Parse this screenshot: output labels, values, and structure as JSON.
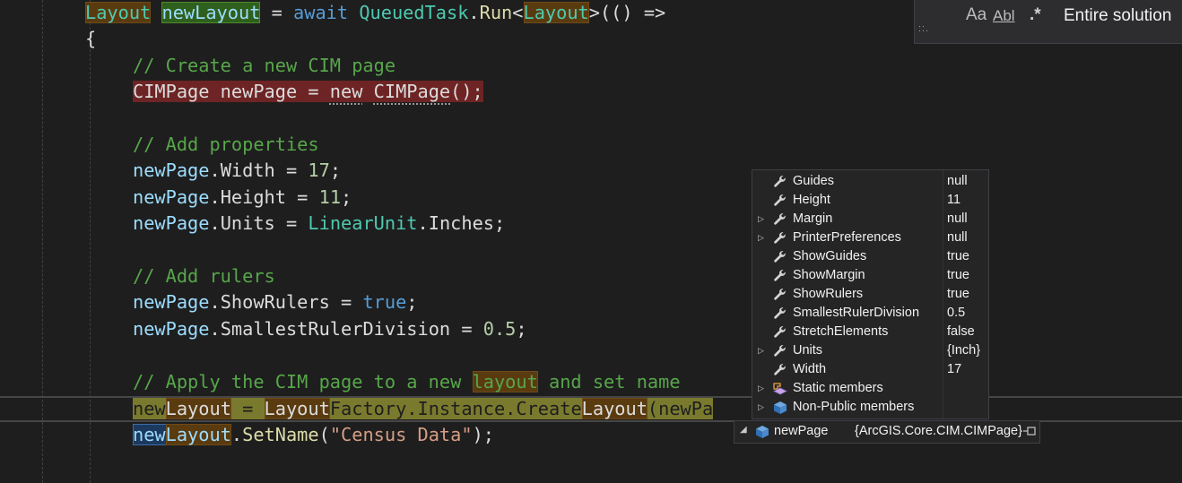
{
  "code": {
    "l1": {
      "t1": "Layout",
      "t2": "newLayout",
      "t3": " = ",
      "t4": "await",
      "t5": "QueuedTask",
      "t6": ".",
      "t7": "Run",
      "t8": "<",
      "t9": "Layout",
      "t10": ">(() =>"
    },
    "l2": {
      "t1": "{"
    },
    "l3": {
      "t1": "// Create a new CIM page"
    },
    "l4": {
      "t1": "CIMPage newPage = ",
      "t2": "new",
      "t3": " ",
      "t4": "CIMPage",
      "t5": "();"
    },
    "l5": {
      "t1": "// Add properties"
    },
    "l6": {
      "t1": "newPage",
      "t2": ".",
      "t3": "Width",
      "t4": " = ",
      "t5": "17",
      "t6": ";"
    },
    "l7": {
      "t1": "newPage",
      "t2": ".",
      "t3": "Height",
      "t4": " = ",
      "t5": "11",
      "t6": ";"
    },
    "l8": {
      "t1": "newPage",
      "t2": ".",
      "t3": "Units",
      "t4": " = ",
      "t5": "LinearUnit",
      "t6": ".",
      "t7": "Inches",
      "t8": ";"
    },
    "l9": {
      "t1": "// Add rulers"
    },
    "l10": {
      "t1": "newPage",
      "t2": ".",
      "t3": "ShowRulers",
      "t4": " = ",
      "t5": "true",
      "t6": ";"
    },
    "l11": {
      "t1": "newPage",
      "t2": ".",
      "t3": "SmallestRulerDivision",
      "t4": " = ",
      "t5": "0.5",
      "t6": ";"
    },
    "l12": {
      "t1": "// Apply the CIM page to a new ",
      "t2": "layout",
      "t3": " and set name"
    },
    "l13": {
      "t1": "new",
      "t2": "Layout",
      "t3": " = ",
      "t4": "Layout",
      "t5": "Factory.Instance.Create",
      "t6": "Layout",
      "t7": "(newPa"
    },
    "l14": {
      "t1": "new",
      "t2": "Layout",
      "t3": ".",
      "t4": "SetName",
      "t5": "(",
      "t6": "\"Census Data\"",
      "t7": ");"
    }
  },
  "find_widget": {
    "match_case": "Aa",
    "whole_word": "Abl",
    "regex": ".*",
    "scope": "Entire solution",
    "grip": "::."
  },
  "datatip": {
    "rows": [
      {
        "name": "Guides",
        "value": "null",
        "expandable": false,
        "icon": "wrench-icon"
      },
      {
        "name": "Height",
        "value": "11",
        "expandable": false,
        "icon": "wrench-icon"
      },
      {
        "name": "Margin",
        "value": "null",
        "expandable": true,
        "icon": "wrench-icon"
      },
      {
        "name": "PrinterPreferences",
        "value": "null",
        "expandable": true,
        "icon": "wrench-icon"
      },
      {
        "name": "ShowGuides",
        "value": "true",
        "expandable": false,
        "icon": "wrench-icon"
      },
      {
        "name": "ShowMargin",
        "value": "true",
        "expandable": false,
        "icon": "wrench-icon"
      },
      {
        "name": "ShowRulers",
        "value": "true",
        "expandable": false,
        "icon": "wrench-icon"
      },
      {
        "name": "SmallestRulerDivision",
        "value": "0.5",
        "expandable": false,
        "icon": "wrench-icon"
      },
      {
        "name": "StretchElements",
        "value": "false",
        "expandable": false,
        "icon": "wrench-icon"
      },
      {
        "name": "Units",
        "value": "{Inch}",
        "expandable": true,
        "icon": "wrench-icon"
      },
      {
        "name": "Width",
        "value": "17",
        "expandable": false,
        "icon": "wrench-icon"
      },
      {
        "name": "Static members",
        "value": "",
        "expandable": true,
        "icon": "static-members-icon"
      },
      {
        "name": "Non-Public members",
        "value": "",
        "expandable": true,
        "icon": "non-public-members-icon"
      }
    ],
    "root": {
      "name": "newPage",
      "value": "{ArcGIS.Core.CIM.CIMPage}",
      "icon": "object-icon"
    }
  },
  "colors": {
    "background": "#1e1e1e",
    "keyword": "#569cd6",
    "type": "#4ec9b0",
    "comment": "#57a64a",
    "string": "#d69d85"
  }
}
